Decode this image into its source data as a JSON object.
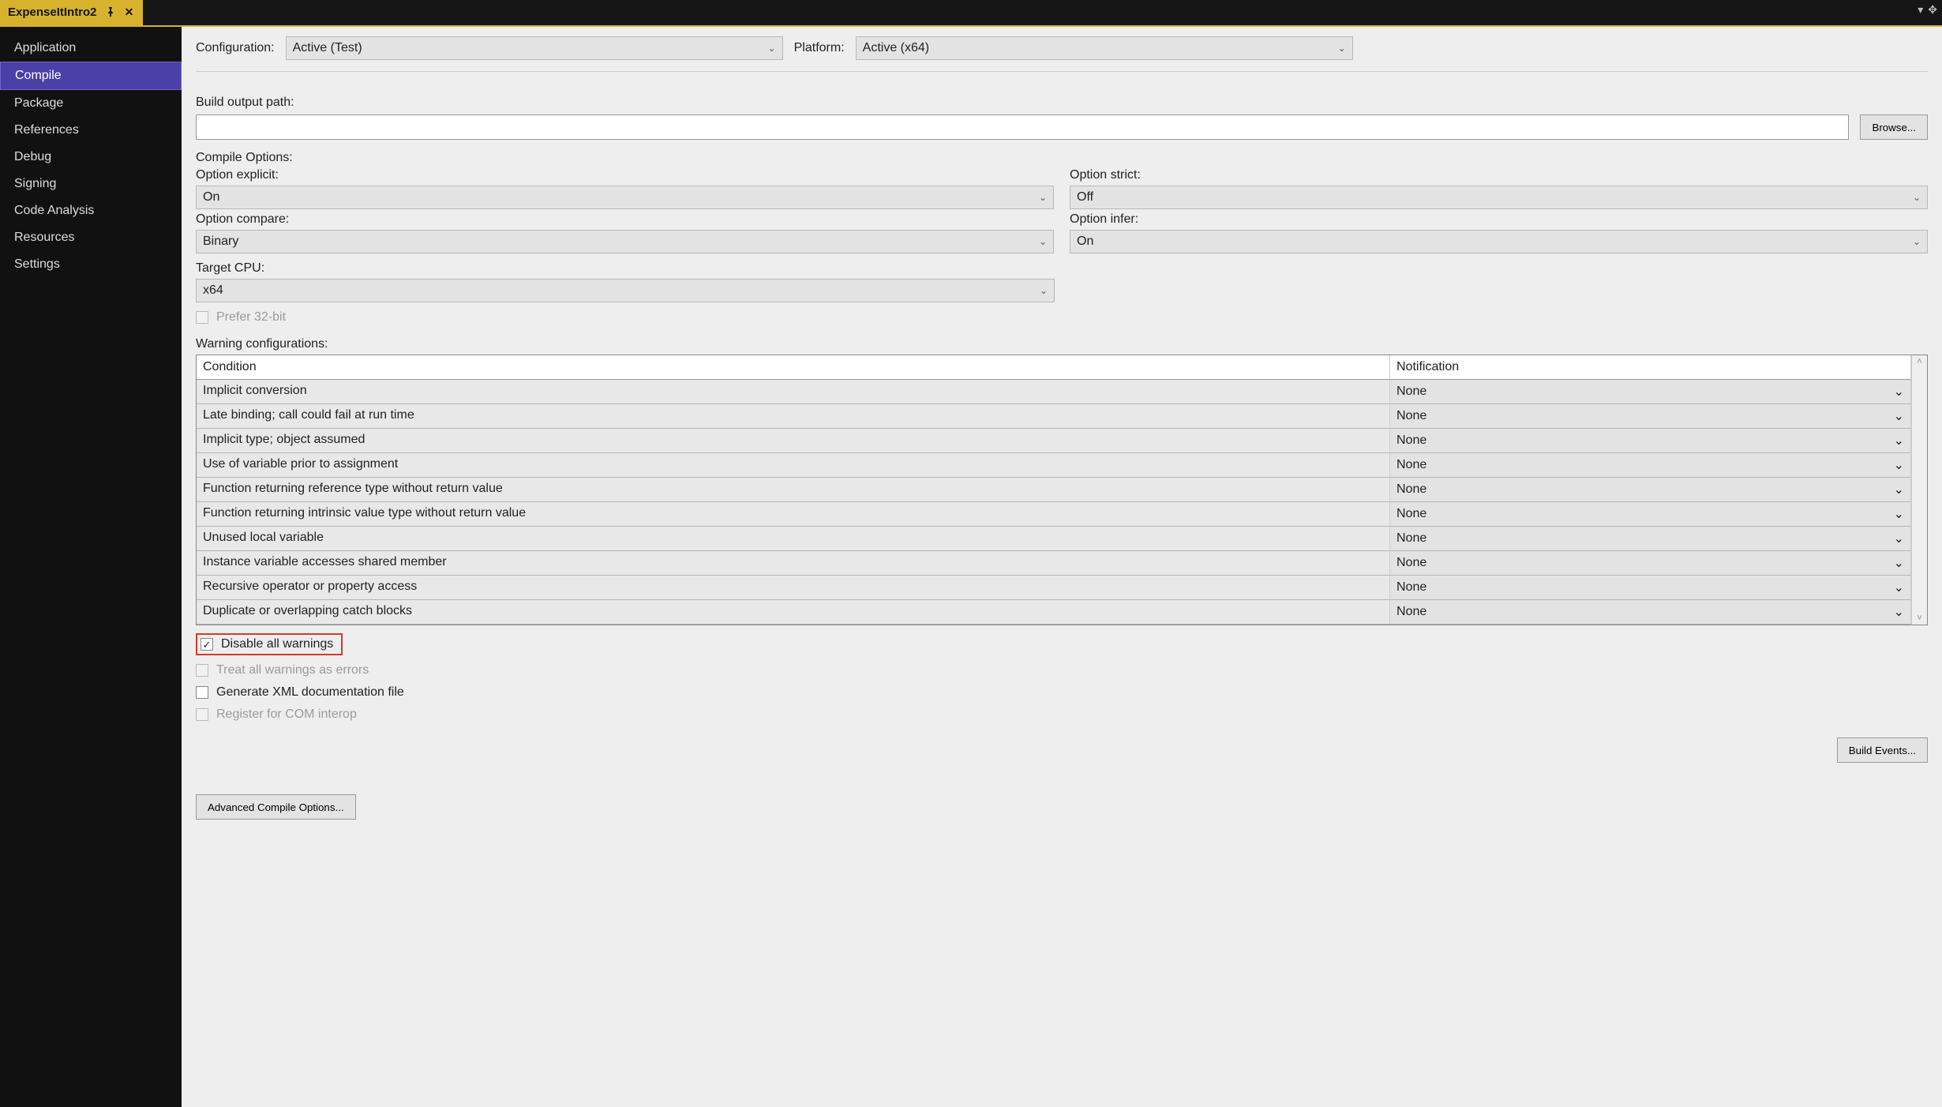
{
  "tab": {
    "title": "ExpenseItIntro2"
  },
  "sidebar": {
    "items": [
      {
        "label": "Application"
      },
      {
        "label": "Compile",
        "selected": true
      },
      {
        "label": "Package"
      },
      {
        "label": "References"
      },
      {
        "label": "Debug"
      },
      {
        "label": "Signing"
      },
      {
        "label": "Code Analysis"
      },
      {
        "label": "Resources"
      },
      {
        "label": "Settings"
      }
    ]
  },
  "top": {
    "configuration_label": "Configuration:",
    "configuration_value": "Active (Test)",
    "platform_label": "Platform:",
    "platform_value": "Active (x64)"
  },
  "build": {
    "path_label": "Build output path:",
    "path_value": "",
    "browse_label": "Browse..."
  },
  "compileOptions": {
    "header": "Compile Options:",
    "explicit_label": "Option explicit:",
    "explicit_value": "On",
    "strict_label": "Option strict:",
    "strict_value": "Off",
    "compare_label": "Option compare:",
    "compare_value": "Binary",
    "infer_label": "Option infer:",
    "infer_value": "On",
    "target_label": "Target CPU:",
    "target_value": "x64",
    "prefer32_label": "Prefer 32-bit"
  },
  "warnings": {
    "header": "Warning configurations:",
    "col_condition": "Condition",
    "col_notification": "Notification",
    "rows": [
      {
        "condition": "Implicit conversion",
        "notification": "None"
      },
      {
        "condition": "Late binding; call could fail at run time",
        "notification": "None"
      },
      {
        "condition": "Implicit type; object assumed",
        "notification": "None"
      },
      {
        "condition": "Use of variable prior to assignment",
        "notification": "None"
      },
      {
        "condition": "Function returning reference type without return value",
        "notification": "None"
      },
      {
        "condition": "Function returning intrinsic value type without return value",
        "notification": "None"
      },
      {
        "condition": "Unused local variable",
        "notification": "None"
      },
      {
        "condition": "Instance variable accesses shared member",
        "notification": "None"
      },
      {
        "condition": "Recursive operator or property access",
        "notification": "None"
      },
      {
        "condition": "Duplicate or overlapping catch blocks",
        "notification": "None"
      }
    ]
  },
  "checks": {
    "disable_all": "Disable all warnings",
    "treat_all": "Treat all warnings as errors",
    "gen_xml": "Generate XML documentation file",
    "register_com": "Register for COM interop"
  },
  "buttons": {
    "build_events": "Build Events...",
    "advanced": "Advanced Compile Options..."
  }
}
